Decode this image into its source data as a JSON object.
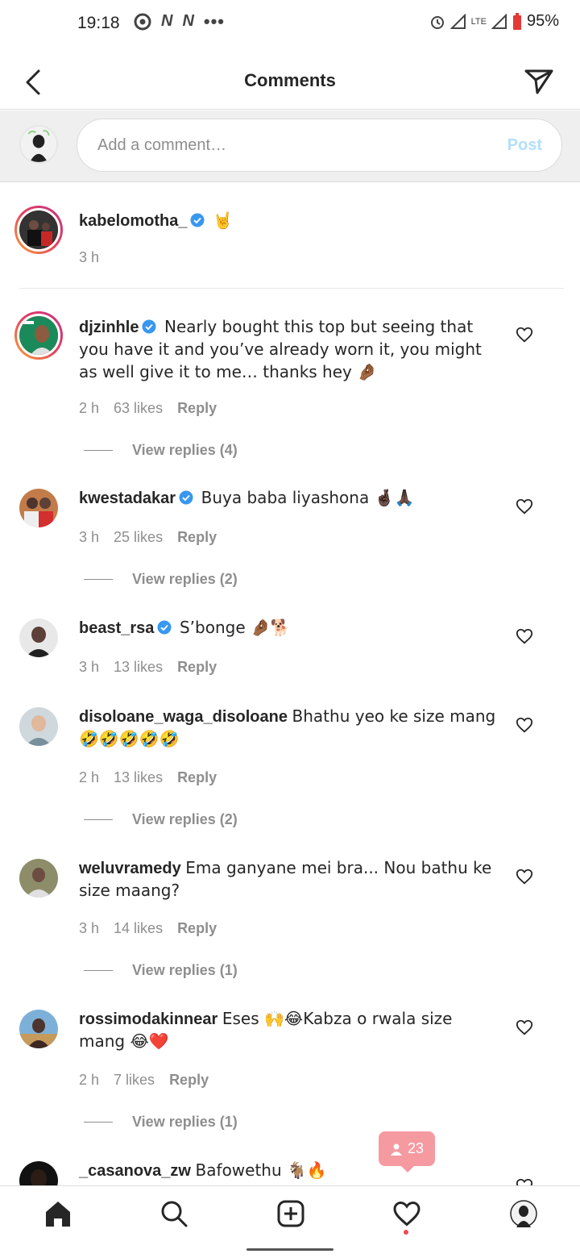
{
  "status_bar": {
    "time": "19:18",
    "network": "LTE",
    "battery": "95%"
  },
  "header": {
    "title": "Comments"
  },
  "composer": {
    "placeholder": "Add a comment…",
    "post_label": "Post"
  },
  "caption": {
    "username": "kabelomotha_",
    "verified": true,
    "text": "🤘",
    "time": "3 h"
  },
  "comments": [
    {
      "username": "djzinhle",
      "verified": true,
      "text": "Nearly bought this top but seeing that you have it and you’ve already worn it, you might as well give it to me… thanks hey 🤌🏾",
      "time": "2 h",
      "likes": "63 likes",
      "reply": "Reply",
      "view_replies": "View replies (4)"
    },
    {
      "username": "kwestadakar",
      "verified": true,
      "text": "Buya baba liyashona 🤞🏿🙏🏿",
      "time": "3 h",
      "likes": "25 likes",
      "reply": "Reply",
      "view_replies": "View replies (2)"
    },
    {
      "username": "beast_rsa",
      "verified": true,
      "text": "S’bonge 🤌🏾🐕",
      "time": "3 h",
      "likes": "13 likes",
      "reply": "Reply",
      "view_replies": ""
    },
    {
      "username": "disoloane_waga_disoloane",
      "verified": false,
      "text": "Bhathu yeo ke size mang 🤣🤣🤣🤣🤣",
      "time": "2 h",
      "likes": "13 likes",
      "reply": "Reply",
      "view_replies": "View replies (2)"
    },
    {
      "username": "weluvramedy",
      "verified": false,
      "text": "Ema ganyane mei bra... Nou bathu ke size maang?",
      "time": "3 h",
      "likes": "14 likes",
      "reply": "Reply",
      "view_replies": "View replies (1)"
    },
    {
      "username": "rossimodakinnear",
      "verified": false,
      "text": "Eses 🙌😂Kabza o rwala size mang 😂❤️",
      "time": "2 h",
      "likes": "7 likes",
      "reply": "Reply",
      "view_replies": "View replies (1)"
    },
    {
      "username": "_casanova_zw",
      "verified": false,
      "text": "Bafowethu 🐐🔥",
      "time": "",
      "likes": "",
      "reply": "",
      "view_replies": ""
    }
  ],
  "activity_badge": {
    "count": "23"
  },
  "nav": {
    "items": [
      "home-icon",
      "search-icon",
      "new-post-icon",
      "activity-heart-icon",
      "profile-avatar"
    ]
  },
  "colors": {
    "accent_blue": "#3897f0",
    "post_disabled": "#b2dffc",
    "notification_red": "#ed4956",
    "text_primary": "#262626",
    "text_secondary": "#8e8e8e"
  }
}
